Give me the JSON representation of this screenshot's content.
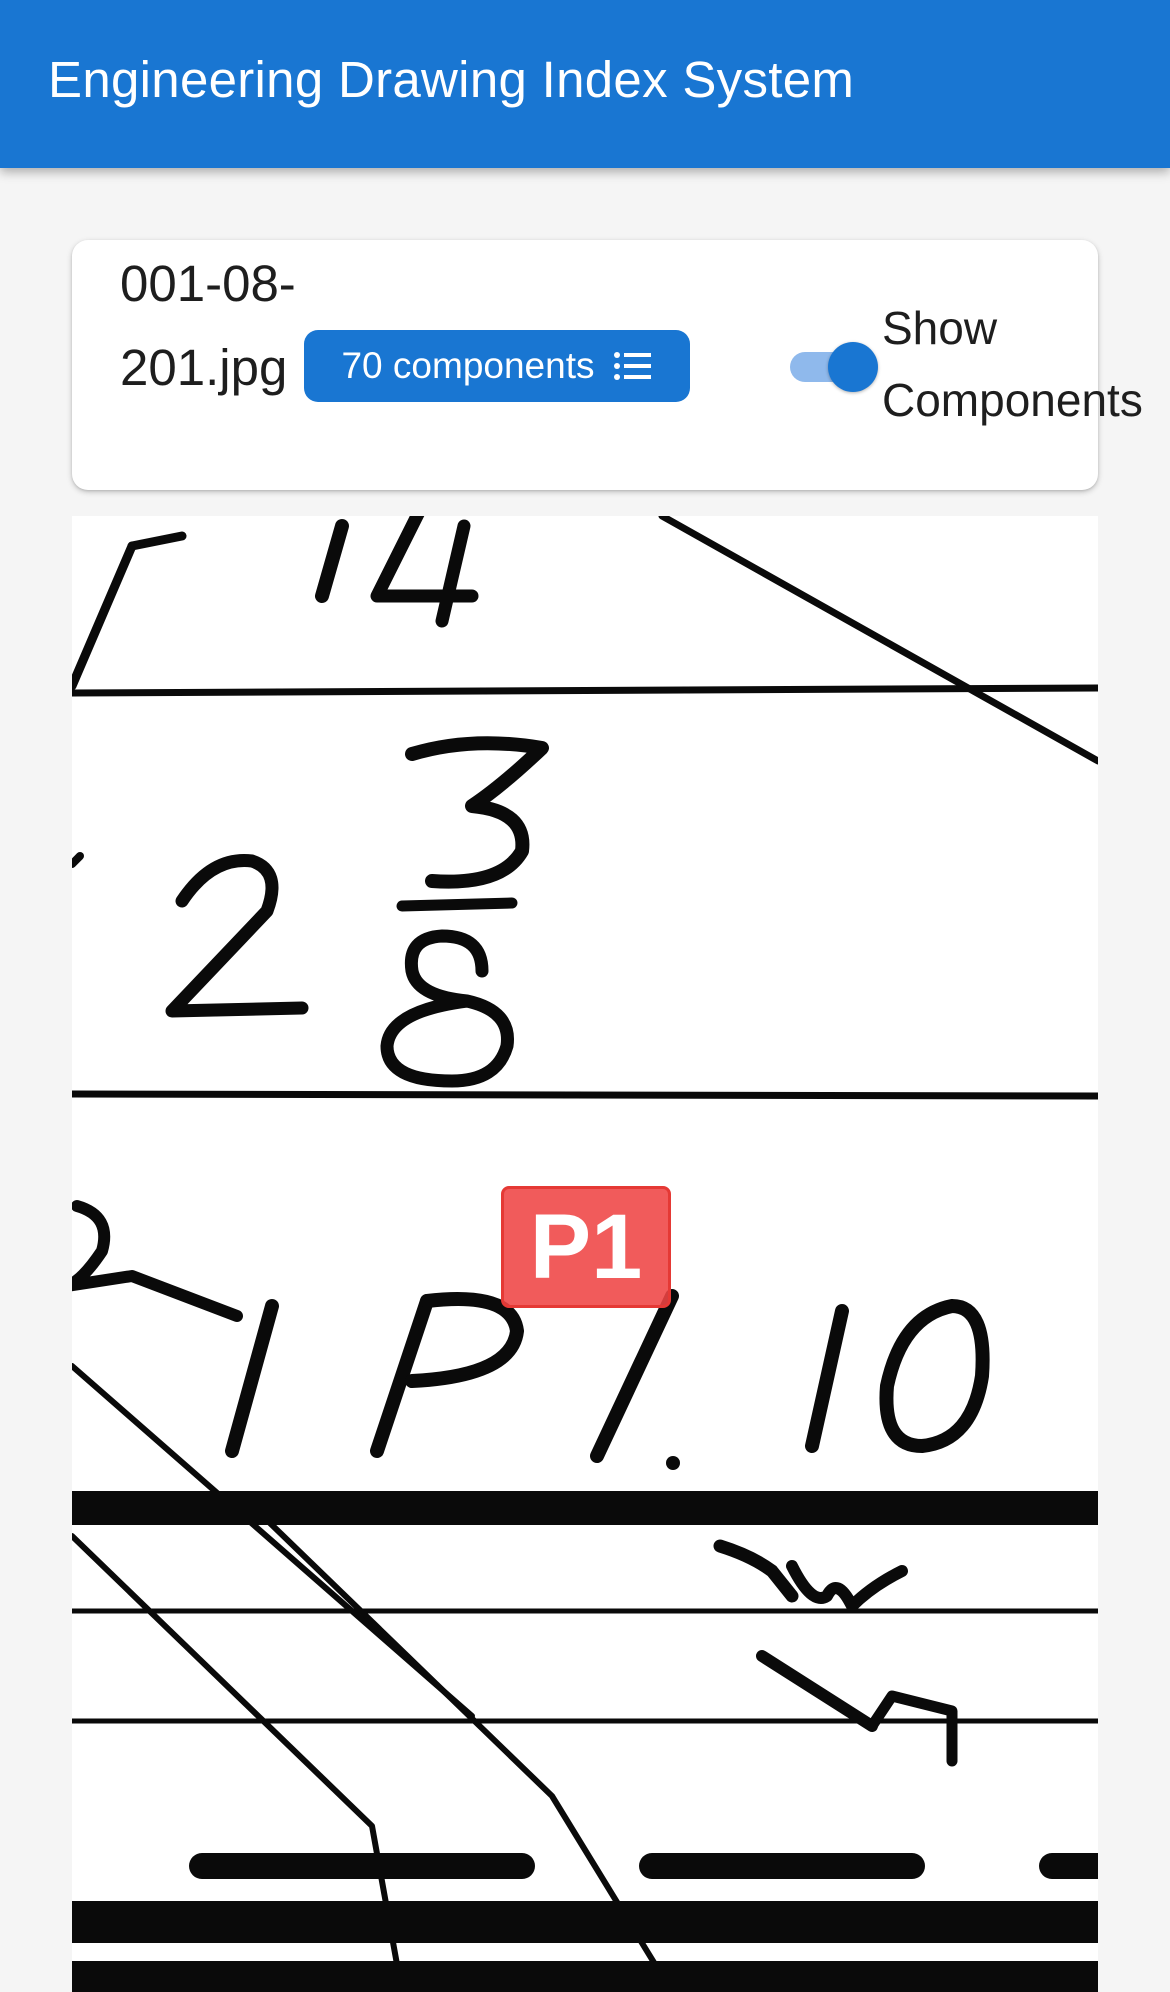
{
  "app": {
    "title": "Engineering Drawing Index System"
  },
  "toolbar": {
    "filename": "001-08-201.jpg",
    "components_count_label": "70 components",
    "components_icon": "list-icon",
    "toggle_label": "Show\nComponents",
    "toggle_on": true
  },
  "drawing": {
    "component_markers": [
      {
        "label": "P1",
        "color": "#ef4444"
      }
    ]
  },
  "colors": {
    "primary": "#1976d2",
    "marker": "#ef4444"
  }
}
